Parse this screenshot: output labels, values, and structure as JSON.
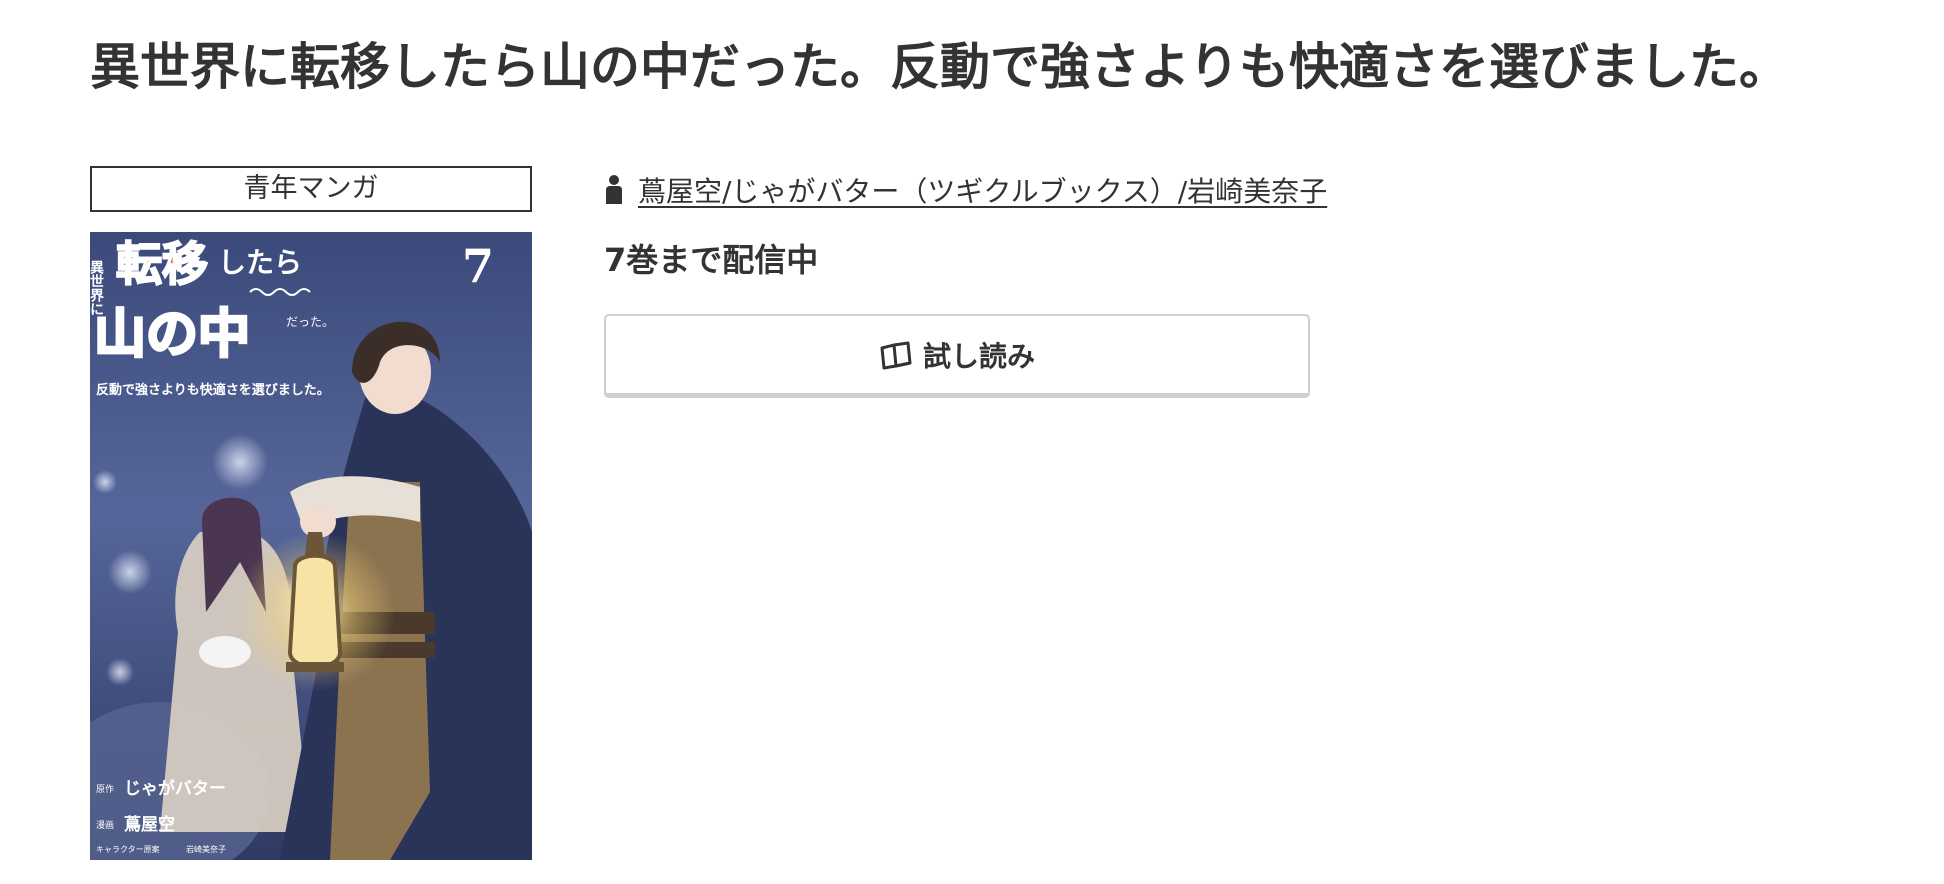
{
  "title": "異世界に転移したら山の中だった。反動で強さよりも快適さを選びました。",
  "genre": "青年マンガ",
  "author": {
    "icon": "person-icon",
    "label": "蔦屋空/じゃがバター（ツギクルブックス）/岩崎美奈子"
  },
  "availability": "7巻まで配信中",
  "trial_button": {
    "icon": "open-book-icon",
    "label": "試し読み"
  },
  "cover": {
    "volume_number": "7",
    "title_lines": [
      "異世界に",
      "転移",
      "したら",
      "山の中",
      "だった。"
    ],
    "subtitle": "反動で強さよりも快適さを選びました。",
    "credit_original_label": "原作",
    "credit_original": "じゃがバター",
    "credit_art_label": "漫画",
    "credit_art": "蔦屋空",
    "credit_character_label": "キャラクター原案",
    "credit_character": "岩崎美奈子",
    "colors": {
      "orange": "#e0622b",
      "green": "#3c9a3c",
      "background": "#4a5a88"
    }
  }
}
